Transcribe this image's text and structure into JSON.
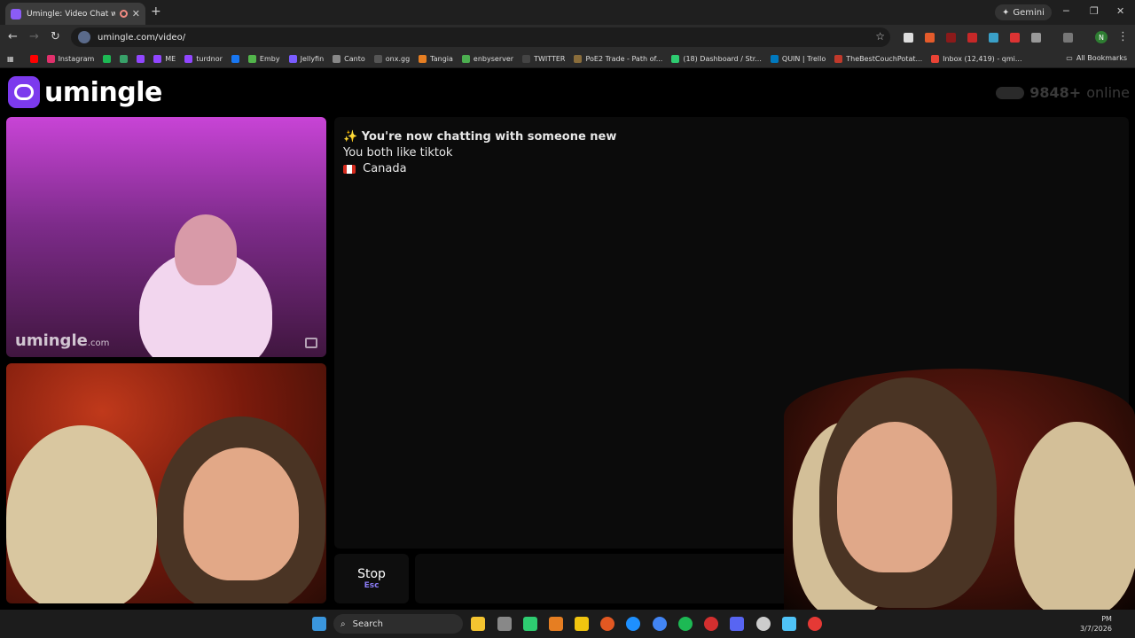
{
  "browser": {
    "tab_title": "Umingle: Video Chat with S",
    "new_tab": "+",
    "gemini_label": "Gemini",
    "url": "umingle.com/video/",
    "bookmarks": [
      {
        "label": "",
        "color": "#ff0000"
      },
      {
        "label": "Instagram",
        "color": "#e1306c"
      },
      {
        "label": "",
        "color": "#1db954"
      },
      {
        "label": "",
        "color": "#38a169"
      },
      {
        "label": "",
        "color": "#9146ff"
      },
      {
        "label": "ME",
        "color": "#9146ff"
      },
      {
        "label": "turdnor",
        "color": "#9146ff"
      },
      {
        "label": "",
        "color": "#1877f2"
      },
      {
        "label": "Emby",
        "color": "#52b54b"
      },
      {
        "label": "Jellyfin",
        "color": "#7a5cff"
      },
      {
        "label": "Canto",
        "color": "#888888"
      },
      {
        "label": "onx.gg",
        "color": "#555555"
      },
      {
        "label": "Tangia",
        "color": "#e67e22"
      },
      {
        "label": "enbyserver",
        "color": "#4caf50"
      },
      {
        "label": "TWITTER",
        "color": "#444444"
      },
      {
        "label": "PoE2 Trade - Path of...",
        "color": "#8a6d3b"
      },
      {
        "label": "(18) Dashboard / Str...",
        "color": "#2ecc71"
      },
      {
        "label": "QUIN | Trello",
        "color": "#0079bf"
      },
      {
        "label": "TheBestCouchPotat...",
        "color": "#c0392b"
      },
      {
        "label": "Inbox (12,419) - qmi...",
        "color": "#ea4335"
      }
    ],
    "all_bookmarks": "All Bookmarks",
    "profile_initial": "N"
  },
  "site": {
    "logo_text": "umingle",
    "online_count": "9848+",
    "online_label": "online",
    "watermark": "umingle",
    "watermark_suffix": ".com"
  },
  "chat": {
    "headline_icon": "✨",
    "headline": "You're now chatting with someone new",
    "interest": "You both like tiktok",
    "country": "Canada"
  },
  "controls": {
    "stop_label": "Stop",
    "stop_key": "Esc",
    "message_placeholder": ""
  },
  "taskbar": {
    "search_label": "Search",
    "time": "PM",
    "date": "3/7/2026"
  }
}
